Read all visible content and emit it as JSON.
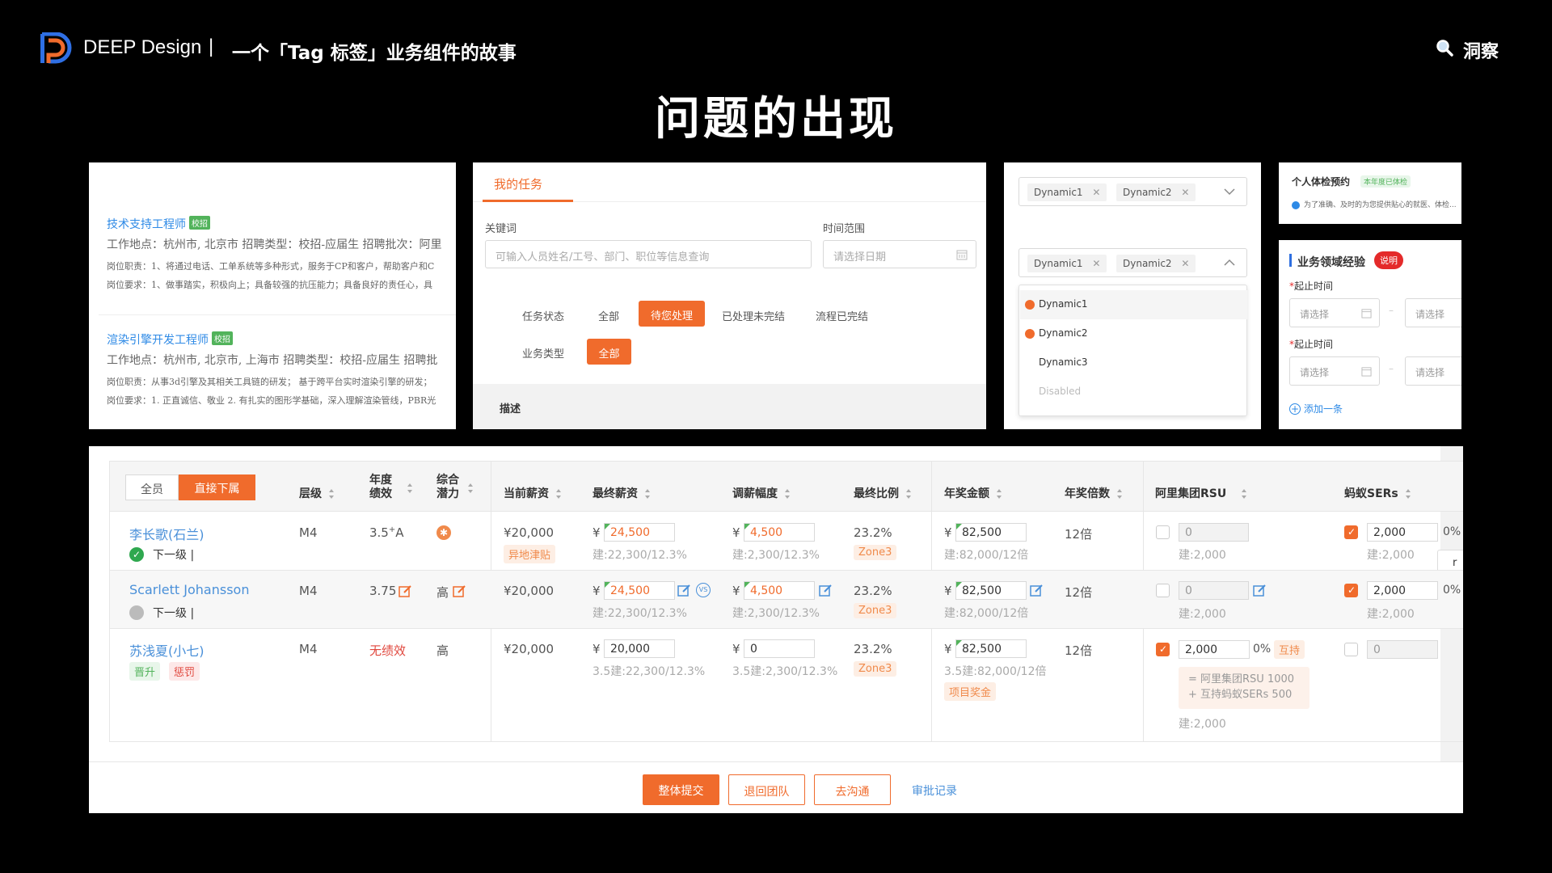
{
  "header": {
    "brand": "DEEP Design",
    "separator": "|",
    "subtitle": "一个「Tag 标签」业务组件的故事",
    "insight_label": "洞察",
    "title": "问题的出现"
  },
  "jobs_panel": {
    "jobs": [
      {
        "title": "技术支持工程师",
        "tag": "校招",
        "meta": "工作地点：杭州市, 北京市      招聘类型：校招-应届生      招聘批次：阿里",
        "duty": "岗位职责：1、将通过电话、工单系统等多种形式，服务于CP和客户，帮助客户和C",
        "req": "岗位要求：1、做事踏实，积极向上；具备较强的抗压能力；具备良好的责任心，具"
      },
      {
        "title": "渲染引擎开发工程师",
        "tag": "校招",
        "meta": "工作地点：杭州市, 北京市, 上海市      招聘类型：校招-应届生      招聘批",
        "duty": "岗位职责：从事3d引擎及其相关工具链的研发；  基于跨平台实时渲染引擎的研发；",
        "req": "岗位要求：1. 正直诚信、敬业 2. 有扎实的图形学基础，深入理解渲染管线，PBR光"
      }
    ]
  },
  "task_panel": {
    "tab": "我的任务",
    "keyword_label": "关键词",
    "keyword_placeholder": "可输入人员姓名/工号、部门、职位等信息查询",
    "range_label": "时间范围",
    "date_placeholder": "请选择日期",
    "status_label": "任务状态",
    "status_options": [
      "全部",
      "待您处理",
      "已处理未完结",
      "流程已完结"
    ],
    "biz_label": "业务类型",
    "biz_selected": "全部",
    "desc_label": "描述"
  },
  "select_panel": {
    "tags": [
      "Dynamic1",
      "Dynamic2"
    ],
    "options": [
      "Dynamic1",
      "Dynamic2",
      "Dynamic3",
      "Disabled"
    ]
  },
  "form_panel": {
    "title": "个人体检预约",
    "title_tag": "本年度已体检",
    "notice": "为了准确、及时的为您提供贴心的就医、体检...",
    "section_title": "业务领域经验",
    "section_badge": "说明",
    "field_label": "起止时间",
    "date_placeholder": "请选择",
    "add_label": "添加一条"
  },
  "table": {
    "filter_all": "全员",
    "filter_direct": "直接下属",
    "headers": [
      "层级",
      "年度绩效",
      "综合潜力",
      "当前薪资",
      "最终薪资",
      "调薪幅度",
      "最终比例",
      "年奖金额",
      "年奖倍数",
      "阿里集团RSU",
      "蚂蚁SERs"
    ],
    "rows": [
      {
        "name": "李长歌(石兰)",
        "sub": "下一级 |",
        "level": "M4",
        "perf": "3.5",
        "perf_sup": "+",
        "perf_tail": "A",
        "cur_salary": "¥20,000",
        "cur_tag": "异地津贴",
        "yen": "¥",
        "final_salary": "24,500",
        "final_sub": "建:22,300/12.3%",
        "raise": "4,500",
        "raise_sub": "建:2,300/12.3%",
        "ratio": "23.2%",
        "ratio_tag": "Zone3",
        "bonus": "82,500",
        "bonus_sub": "建:82,000/12倍",
        "multiple": "12倍",
        "rsu": "0",
        "rsu_sub": "建:2,000",
        "sers": "2,000",
        "sers_pct": "0%",
        "sers_sub": "建:2,000"
      },
      {
        "name": "Scarlett Johansson",
        "sub": "下一级 |",
        "level": "M4",
        "perf": "3.75",
        "potential": "高",
        "cur_salary": "¥20,000",
        "yen": "¥",
        "final_salary": "24,500",
        "final_sub": "建:22,300/12.3%",
        "raise": "4,500",
        "raise_sub": "建:2,300/12.3%",
        "ratio": "23.2%",
        "ratio_tag": "Zone3",
        "bonus": "82,500",
        "bonus_sub": "建:82,000/12倍",
        "multiple": "12倍",
        "rsu": "0",
        "rsu_sub": "建:2,000",
        "sers": "2,000",
        "sers_pct": "0%",
        "sers_sub": "建:2,000"
      },
      {
        "name": "苏浅夏(小七)",
        "tag1": "晋升",
        "tag2": "惩罚",
        "level": "M4",
        "perf": "无绩效",
        "potential": "高",
        "cur_salary": "¥20,000",
        "yen": "¥",
        "final_salary": "20,000",
        "final_sub": "3.5建:22,300/12.3%",
        "raise": "0",
        "raise_sub": "3.5建:2,300/12.3%",
        "ratio": "23.2%",
        "ratio_tag": "Zone3",
        "bonus": "82,500",
        "bonus_sub": "3.5建:82,000/12倍",
        "bonus_tag": "项目奖金",
        "multiple": "12倍",
        "rsu": "2,000",
        "rsu_pct": "0%",
        "rsu_tag": "互持",
        "rsu_note1": "= 阿里集团RSU 1000",
        "rsu_note2": "+ 互持蚂蚁SERs 500",
        "rsu_sub": "建:2,000",
        "sers": "0"
      }
    ],
    "side_clip": "r"
  },
  "footer": {
    "submit": "整体提交",
    "return": "退回团队",
    "talk": "去沟通",
    "log": "审批记录"
  },
  "colors": {
    "accent": "#f06b2c",
    "link": "#4a90d9",
    "success": "#52b35b",
    "danger": "#e0463c"
  }
}
